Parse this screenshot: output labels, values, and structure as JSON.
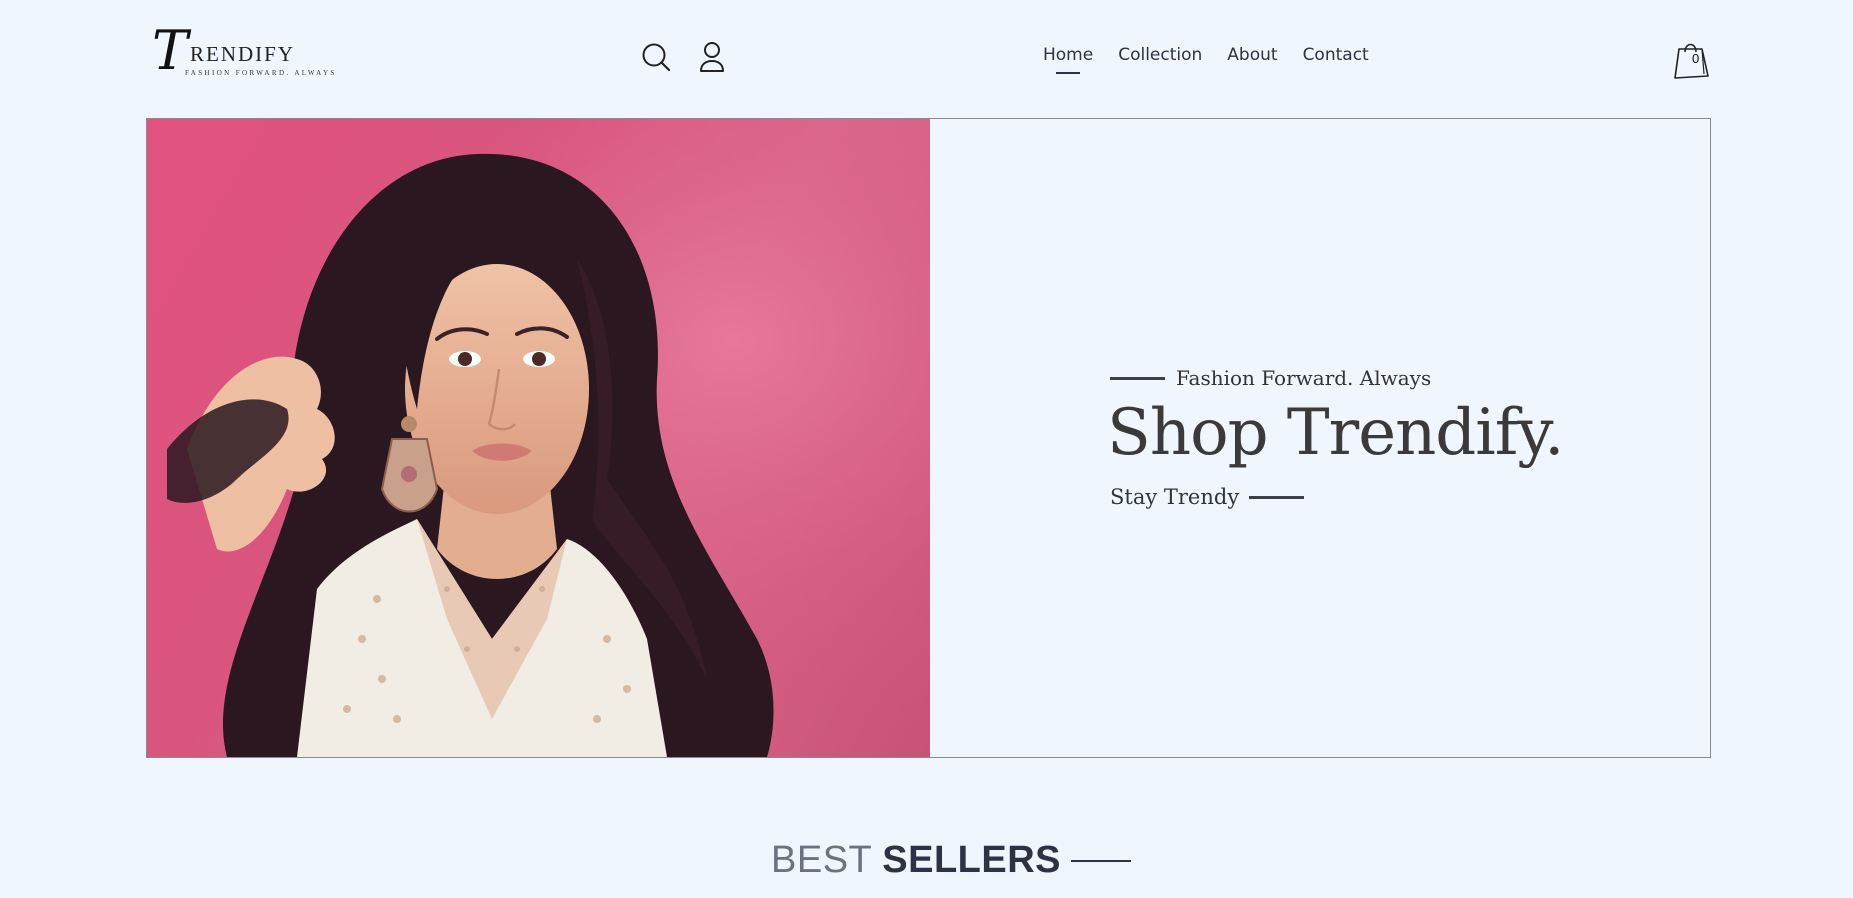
{
  "brand": {
    "logo_letter": "T",
    "logo_word": "RENDIFY",
    "logo_tagline": "FASHION FORWARD. ALWAYS"
  },
  "header": {
    "nav": [
      {
        "label": "Home",
        "active": true
      },
      {
        "label": "Collection",
        "active": false
      },
      {
        "label": "About",
        "active": false
      },
      {
        "label": "Contact",
        "active": false
      }
    ],
    "icons": [
      "search-icon",
      "user-icon",
      "shopping-bag-icon"
    ],
    "cart_count": "0"
  },
  "hero": {
    "tagline": "Fashion Forward. Always",
    "headline": "Shop Trendify.",
    "subline": "Stay Trendy",
    "image_alt": "Woman with long wavy dark hair wearing a white embroidered top and large earrings against a pink background"
  },
  "best_sellers": {
    "title_light": "BEST",
    "title_bold": "SELLERS"
  },
  "colors": {
    "background": "#eff6fe",
    "text_dark": "#2d3345",
    "hero_pink": "#dc5a84",
    "border": "#8a8a8a"
  }
}
